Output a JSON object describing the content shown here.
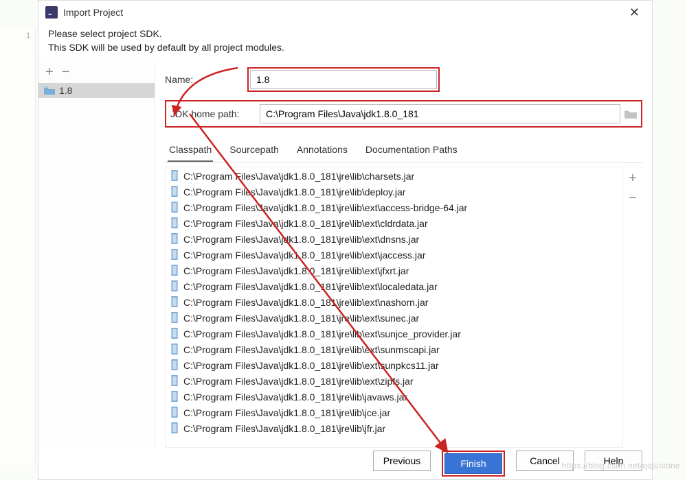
{
  "window": {
    "title": "Import Project"
  },
  "instructions": {
    "line1": "Please select project SDK.",
    "line2": "This SDK will be used by default by all project modules."
  },
  "sidebar": {
    "add_label": "+",
    "remove_label": "−",
    "items": [
      {
        "label": "1.8"
      }
    ]
  },
  "form": {
    "name_label": "Name:",
    "name_value": "1.8",
    "path_label": "JDK home path:",
    "path_value": "C:\\Program Files\\Java\\jdk1.8.0_181"
  },
  "tabs": [
    {
      "label": "Classpath",
      "active": true
    },
    {
      "label": "Sourcepath",
      "active": false
    },
    {
      "label": "Annotations",
      "active": false
    },
    {
      "label": "Documentation Paths",
      "active": false
    }
  ],
  "classpath_tools": {
    "add_label": "+",
    "remove_label": "−"
  },
  "classpath_items": [
    "C:\\Program Files\\Java\\jdk1.8.0_181\\jre\\lib\\charsets.jar",
    "C:\\Program Files\\Java\\jdk1.8.0_181\\jre\\lib\\deploy.jar",
    "C:\\Program Files\\Java\\jdk1.8.0_181\\jre\\lib\\ext\\access-bridge-64.jar",
    "C:\\Program Files\\Java\\jdk1.8.0_181\\jre\\lib\\ext\\cldrdata.jar",
    "C:\\Program Files\\Java\\jdk1.8.0_181\\jre\\lib\\ext\\dnsns.jar",
    "C:\\Program Files\\Java\\jdk1.8.0_181\\jre\\lib\\ext\\jaccess.jar",
    "C:\\Program Files\\Java\\jdk1.8.0_181\\jre\\lib\\ext\\jfxrt.jar",
    "C:\\Program Files\\Java\\jdk1.8.0_181\\jre\\lib\\ext\\localedata.jar",
    "C:\\Program Files\\Java\\jdk1.8.0_181\\jre\\lib\\ext\\nashorn.jar",
    "C:\\Program Files\\Java\\jdk1.8.0_181\\jre\\lib\\ext\\sunec.jar",
    "C:\\Program Files\\Java\\jdk1.8.0_181\\jre\\lib\\ext\\sunjce_provider.jar",
    "C:\\Program Files\\Java\\jdk1.8.0_181\\jre\\lib\\ext\\sunmscapi.jar",
    "C:\\Program Files\\Java\\jdk1.8.0_181\\jre\\lib\\ext\\sunpkcs11.jar",
    "C:\\Program Files\\Java\\jdk1.8.0_181\\jre\\lib\\ext\\zipfs.jar",
    "C:\\Program Files\\Java\\jdk1.8.0_181\\jre\\lib\\javaws.jar",
    "C:\\Program Files\\Java\\jdk1.8.0_181\\jre\\lib\\jce.jar",
    "C:\\Program Files\\Java\\jdk1.8.0_181\\jre\\lib\\jfr.jar"
  ],
  "buttons": {
    "previous": "Previous",
    "finish": "Finish",
    "cancel": "Cancel",
    "help": "Help"
  },
  "watermark": "https://blog.csdn.net/qqjustone"
}
